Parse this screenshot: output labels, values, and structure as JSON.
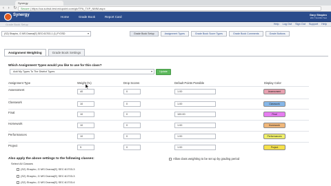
{
  "browser": {
    "tab_title": "Synergy",
    "url_prefix": "Secure",
    "url": "https://ca-suhsd-test.edupoint.com/gb/TPA_TXP_NMM.aspx"
  },
  "header": {
    "logo_text": "Synergy",
    "nav": [
      "Home",
      "Grade Book",
      "Report Card"
    ],
    "user_name": "Gary Shapiro",
    "user_sub": "2017 SUHSD Test"
  },
  "sub_bar": {
    "text": "Grade Book Setup"
  },
  "util_links": [
    "Help",
    "Log Out",
    "Sign Out",
    "Support",
    "Help"
  ],
  "class_select": {
    "value": "(S2) Shapiro, G MS Drama(E) SEC:61703-1 (1)   FY2SD"
  },
  "section_tabs": [
    {
      "label": "Grade Book Setup",
      "active": true
    },
    {
      "label": "Assignment Types",
      "active": false
    },
    {
      "label": "Grade Book Score Types",
      "active": false
    },
    {
      "label": "Grade Book Comments",
      "active": false
    },
    {
      "label": "Grade Buttons",
      "active": false
    }
  ],
  "page_tabs": [
    {
      "label": "Assignment Weighting",
      "active": true
    },
    {
      "label": "Grade Book Settings",
      "active": false
    }
  ],
  "question": "Which Assignment Types would you like to use for this class?",
  "type_select": {
    "value": "Add My Types To The District Types"
  },
  "add_button": "Update",
  "columns": [
    "Assignment Type",
    "Weight (%)",
    "Drop Scores",
    "Default Points Possible",
    "Display Color"
  ],
  "rows": [
    {
      "type": "Assessment",
      "weight": "40",
      "drop": "0",
      "points": "1.00",
      "chip_label": "Assessment",
      "chip_color": "#e7a1b0"
    },
    {
      "type": "Classwork",
      "weight": "10",
      "drop": "0",
      "points": "1.00",
      "chip_label": "Classwork",
      "chip_color": "#86b7e8"
    },
    {
      "type": "Final",
      "weight": "10",
      "drop": "0",
      "points": "100.00",
      "chip_label": "Final",
      "chip_color": "#e57cf0"
    },
    {
      "type": "Homework",
      "weight": "10",
      "drop": "0",
      "points": "1.00",
      "chip_label": "Homework",
      "chip_color": "#f0b77a"
    },
    {
      "type": "Performances",
      "weight": "10",
      "drop": "0",
      "points": "1.00",
      "chip_label": "Performances",
      "chip_color": "#f0f06a"
    },
    {
      "type": "Project",
      "weight": "5",
      "drop": "0",
      "points": "1.00",
      "chip_label": "Project",
      "chip_color": "#f5e04a"
    }
  ],
  "apply": {
    "title": "Also apply the above settings to the following classes:",
    "select_all": "Select All Classes",
    "classes": [
      "(S2) Shapiro, G MS Drama(E) SEC:61703-3",
      "(S2) Shapiro, G MS Drama(E) SEC:61703-3",
      "(S2) Shapiro, G MS Drama(E) SEC:61703-4"
    ],
    "allow_text": "Allow class weighting to be set up by grading period"
  }
}
